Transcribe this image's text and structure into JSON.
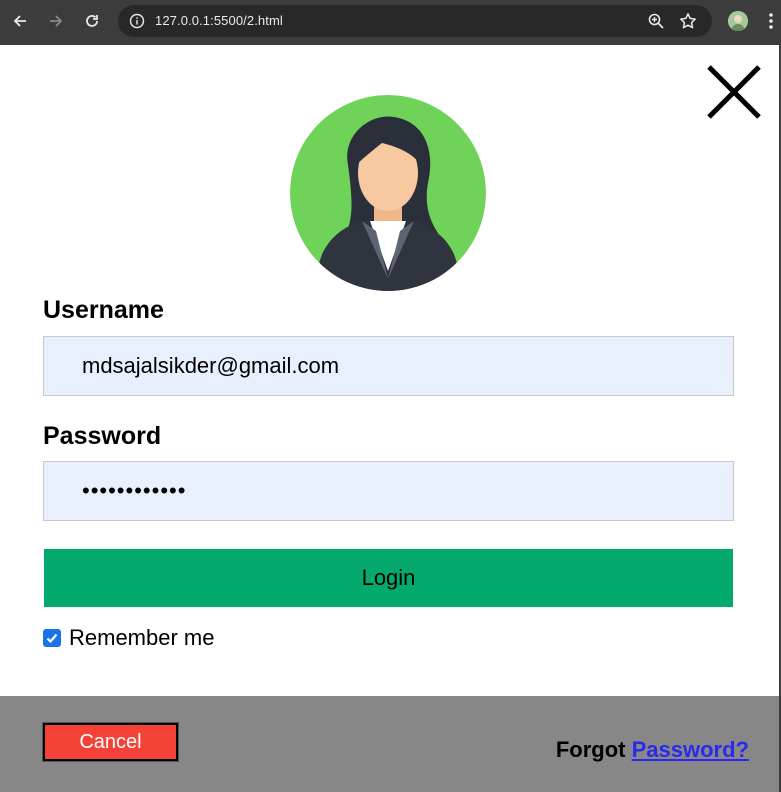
{
  "browser": {
    "url": "127.0.0.1:5500/2.html",
    "icons": [
      "back-icon",
      "forward-icon",
      "reload-icon",
      "site-info-icon",
      "zoom-icon",
      "bookmark-star-icon",
      "profile-avatar",
      "menu-dots-icon"
    ]
  },
  "form": {
    "username_label": "Username",
    "username_value": "mdsajalsikder@gmail.com",
    "password_label": "Password",
    "password_value": "••••••••••••",
    "login_label": "Login",
    "remember_label": "Remember me",
    "remember_checked": true
  },
  "footer": {
    "cancel_label": "Cancel",
    "forgot_prefix": "Forgot",
    "forgot_link": "Password?"
  },
  "colors": {
    "login_bg": "#04aa6d",
    "cancel_bg": "#f44336",
    "footer_bg": "#878787",
    "input_bg": "#e8f0fe",
    "avatar_bg": "#6fd35a",
    "link": "#2a2aee"
  }
}
